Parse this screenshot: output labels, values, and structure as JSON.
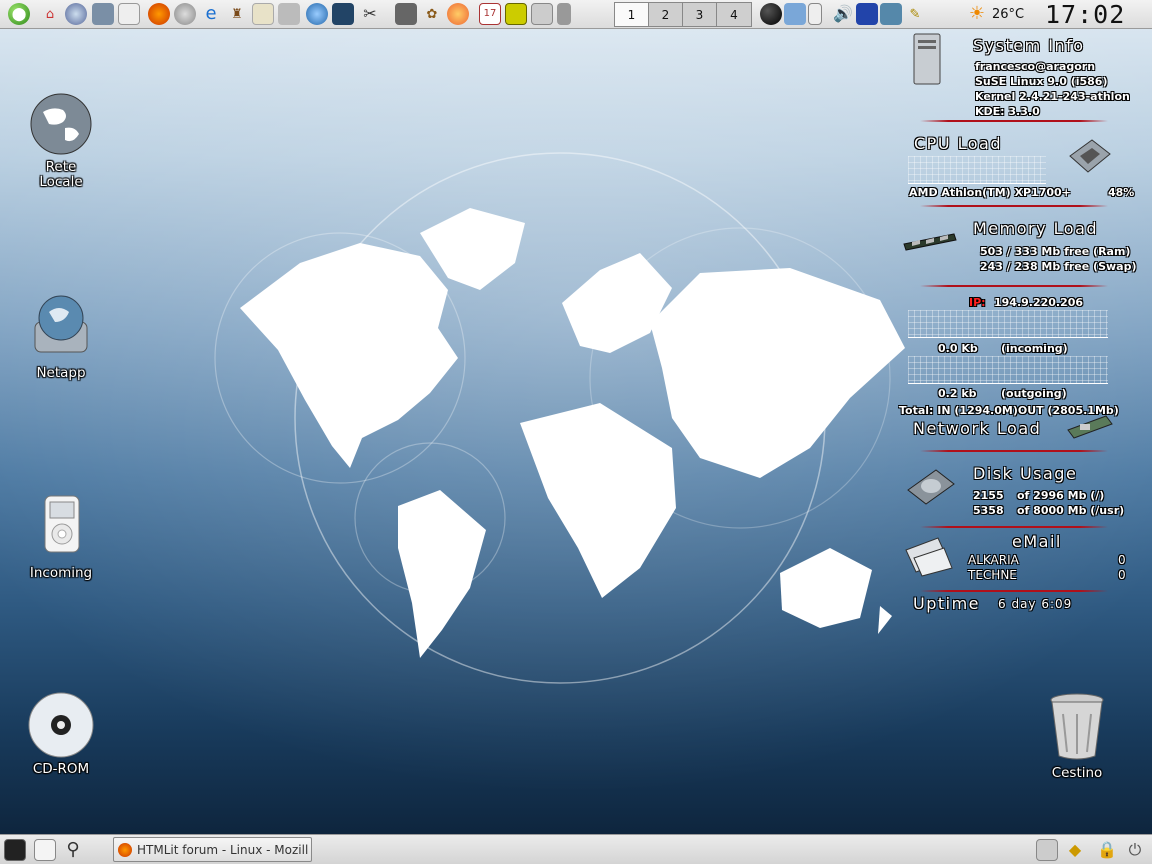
{
  "top_panel": {
    "pager": [
      "1",
      "2",
      "3",
      "4"
    ],
    "active_desktop": "1",
    "weather_temp": "26°C",
    "clock": "17:02"
  },
  "desktop_icons": {
    "rete_locale": "Rete\nLocale",
    "netapp": "Netapp",
    "incoming": "Incoming",
    "cdrom": "CD-ROM",
    "cestino": "Cestino"
  },
  "monitor": {
    "system_info": {
      "title": "System Info",
      "user": "francesco@aragorn",
      "os": "SuSE Linux 9.0 (i586)",
      "kernel": "Kernel 2.4.21-243-athlon",
      "kde": "KDE: 3.3.0"
    },
    "cpu": {
      "title": "CPU Load",
      "model": "AMD Athlon(TM) XP1700+",
      "load": "48%"
    },
    "memory": {
      "title": "Memory Load",
      "ram": "503 / 333 Mb free (Ram)",
      "swap": "243 / 238 Mb free (Swap)"
    },
    "network": {
      "ip_label": "IP:",
      "ip": "194.9.220.206",
      "in_value": "0.0 Kb",
      "in_label": "(incoming)",
      "out_value": "0.2 kb",
      "out_label": "(outgoing)",
      "total": "Total: IN  (1294.0M)OUT   (2805.1Mb)",
      "title": "Network Load"
    },
    "disk": {
      "title": "Disk Usage",
      "root_free": "2155",
      "root_total": "of 2996 Mb (/)",
      "usr_free": "5358",
      "usr_total": "of 8000 Mb (/usr)"
    },
    "email": {
      "title": "eMail",
      "accounts": [
        {
          "name": "ALKARIA",
          "count": "0"
        },
        {
          "name": "TECHNE",
          "count": "0"
        }
      ]
    },
    "uptime": {
      "label": "Uptime",
      "value": "6 day 6:09"
    }
  },
  "taskbar": {
    "window_title": "HTMLit forum - Linux - Mozill"
  }
}
